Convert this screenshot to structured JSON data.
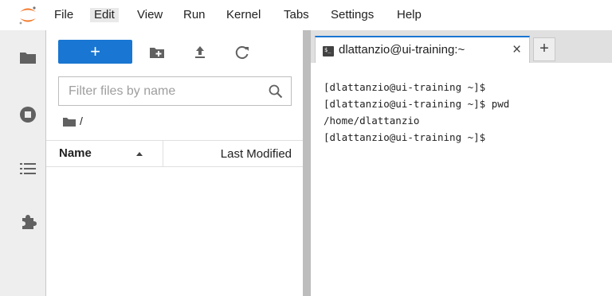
{
  "app": {
    "menus": [
      "File",
      "Edit",
      "View",
      "Run",
      "Kernel",
      "Tabs",
      "Settings",
      "Help"
    ],
    "active_menu": "Edit"
  },
  "sidebar": {
    "icons": [
      "folder-icon",
      "running-icon",
      "list-icon",
      "extension-icon"
    ]
  },
  "filebrowser": {
    "new_label": "+",
    "toolbar_icons": [
      "new-folder-icon",
      "upload-icon",
      "refresh-icon"
    ],
    "filter_placeholder": "Filter files by name",
    "breadcrumb": "/",
    "columns": {
      "name": "Name",
      "modified": "Last Modified"
    },
    "sort": "ascending"
  },
  "tabs": [
    {
      "title": "dlattanzio@ui-training:~",
      "icon": "terminal-icon",
      "icon_text": "$_"
    }
  ],
  "add_tab_label": "+",
  "close_label": "×",
  "terminal": {
    "lines": [
      "[dlattanzio@ui-training ~]$",
      "[dlattanzio@ui-training ~]$ pwd",
      "/home/dlattanzio",
      "[dlattanzio@ui-training ~]$"
    ]
  },
  "colors": {
    "accent": "#1976d2",
    "sidebar_bg": "#eeeeee",
    "logo": "#f37726"
  }
}
